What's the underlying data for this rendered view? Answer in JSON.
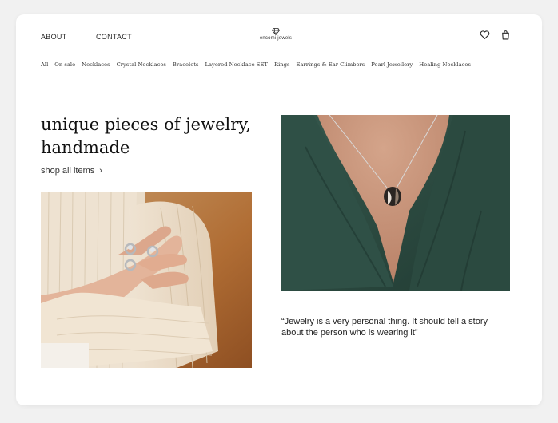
{
  "header": {
    "nav_left": [
      "ABOUT",
      "CONTACT"
    ],
    "logo_text": "encomi jewels",
    "icons": [
      "heart-icon",
      "bag-icon"
    ]
  },
  "categories": [
    "All",
    "On sale",
    "Necklaces",
    "Crystal Necklaces",
    "Bracelets",
    "Layered Necklace SET",
    "Rings",
    "Earrings & Ear Climbers",
    "Pearl Jewellery",
    "Healing Necklaces"
  ],
  "hero": {
    "headline_line1": "unique pieces of jewelry,",
    "headline_line2": "handmade",
    "shop_link": "shop all items",
    "shop_icon": "chevron-right-icon"
  },
  "quote": "“Jewelry is a very personal thing. It should tell a story about the person who is wearing it”",
  "colors": {
    "page_bg": "#f1f1f1",
    "card_bg": "#ffffff",
    "text": "#111111",
    "blouse_green": "#2f4f45"
  }
}
